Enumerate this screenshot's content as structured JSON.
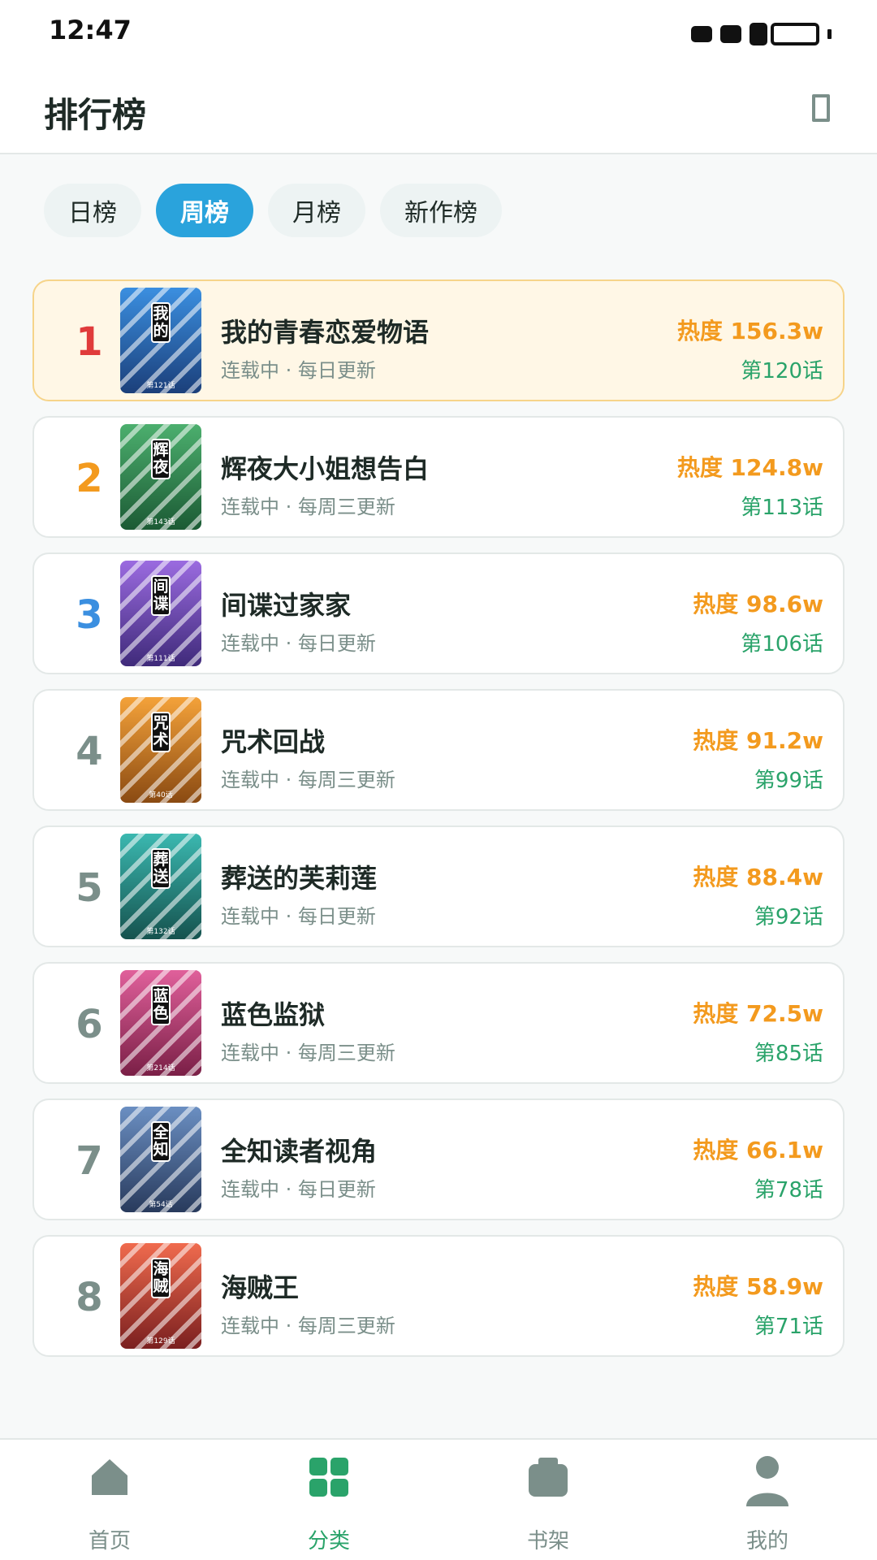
{
  "status_bar": {
    "time": "12:47"
  },
  "header": {
    "title": "排行榜"
  },
  "tabs": [
    {
      "label": "日榜",
      "active": false
    },
    {
      "label": "周榜",
      "active": true
    },
    {
      "label": "月榜",
      "active": false
    },
    {
      "label": "新作榜",
      "active": false
    }
  ],
  "ranking": [
    {
      "rank": "1",
      "title": "我的青春恋爱物语",
      "cover_text": "我的",
      "cover_episode": "第121话",
      "status": "连载中 · 每日更新",
      "heat": "热度 156.3w",
      "episode": "第120话",
      "cover_colors": [
        "#3b8fe0",
        "#1b3f7a"
      ],
      "rank_color": "#e03b3b"
    },
    {
      "rank": "2",
      "title": "辉夜大小姐想告白",
      "cover_text": "辉夜",
      "cover_episode": "第143话",
      "status": "连载中 · 每周三更新",
      "heat": "热度 124.8w",
      "episode": "第113话",
      "cover_colors": [
        "#4caf6e",
        "#1b5a34"
      ],
      "rank_color": "#f39a1e"
    },
    {
      "rank": "3",
      "title": "间谍过家家",
      "cover_text": "间谍",
      "cover_episode": "第111话",
      "status": "连载中 · 每日更新",
      "heat": "热度 98.6w",
      "episode": "第106话",
      "cover_colors": [
        "#9b6be0",
        "#3f2a7a"
      ],
      "rank_color": "#3b8fe0"
    },
    {
      "rank": "4",
      "title": "咒术回战",
      "cover_text": "咒术",
      "cover_episode": "第40话",
      "status": "连载中 · 每周三更新",
      "heat": "热度 91.2w",
      "episode": "第99话",
      "cover_colors": [
        "#f4a23a",
        "#8a4a12"
      ],
      "rank_color": "#7b8f8a"
    },
    {
      "rank": "5",
      "title": "葬送的芙莉莲",
      "cover_text": "葬送",
      "cover_episode": "第132话",
      "status": "连载中 · 每日更新",
      "heat": "热度 88.4w",
      "episode": "第92话",
      "cover_colors": [
        "#3bb8b0",
        "#15524e"
      ],
      "rank_color": "#7b8f8a"
    },
    {
      "rank": "6",
      "title": "蓝色监狱",
      "cover_text": "蓝色",
      "cover_episode": "第214话",
      "status": "连载中 · 每周三更新",
      "heat": "热度 72.5w",
      "episode": "第85话",
      "cover_colors": [
        "#e0609b",
        "#7a1f46"
      ],
      "rank_color": "#7b8f8a"
    },
    {
      "rank": "7",
      "title": "全知读者视角",
      "cover_text": "全知",
      "cover_episode": "第54话",
      "status": "连载中 · 每日更新",
      "heat": "热度 66.1w",
      "episode": "第78话",
      "cover_colors": [
        "#6b8fc2",
        "#283a5c"
      ],
      "rank_color": "#7b8f8a"
    },
    {
      "rank": "8",
      "title": "海贼王",
      "cover_text": "海贼",
      "cover_episode": "第129话",
      "status": "连载中 · 每周三更新",
      "heat": "热度 58.9w",
      "episode": "第71话",
      "cover_colors": [
        "#f06b4e",
        "#7a1f1f"
      ],
      "rank_color": "#7b8f8a"
    }
  ],
  "bottom_nav": [
    {
      "label": "首页",
      "icon": "home-icon",
      "active": false
    },
    {
      "label": "分类",
      "icon": "category-grid-icon",
      "active": true
    },
    {
      "label": "书架",
      "icon": "bookshelf-icon",
      "active": false
    },
    {
      "label": "我的",
      "icon": "profile-icon",
      "active": false
    }
  ],
  "colors": {
    "accent": "#2aa3dc",
    "green": "#2aa36a",
    "heat": "#f39a1e",
    "muted": "#7b8f8a"
  }
}
